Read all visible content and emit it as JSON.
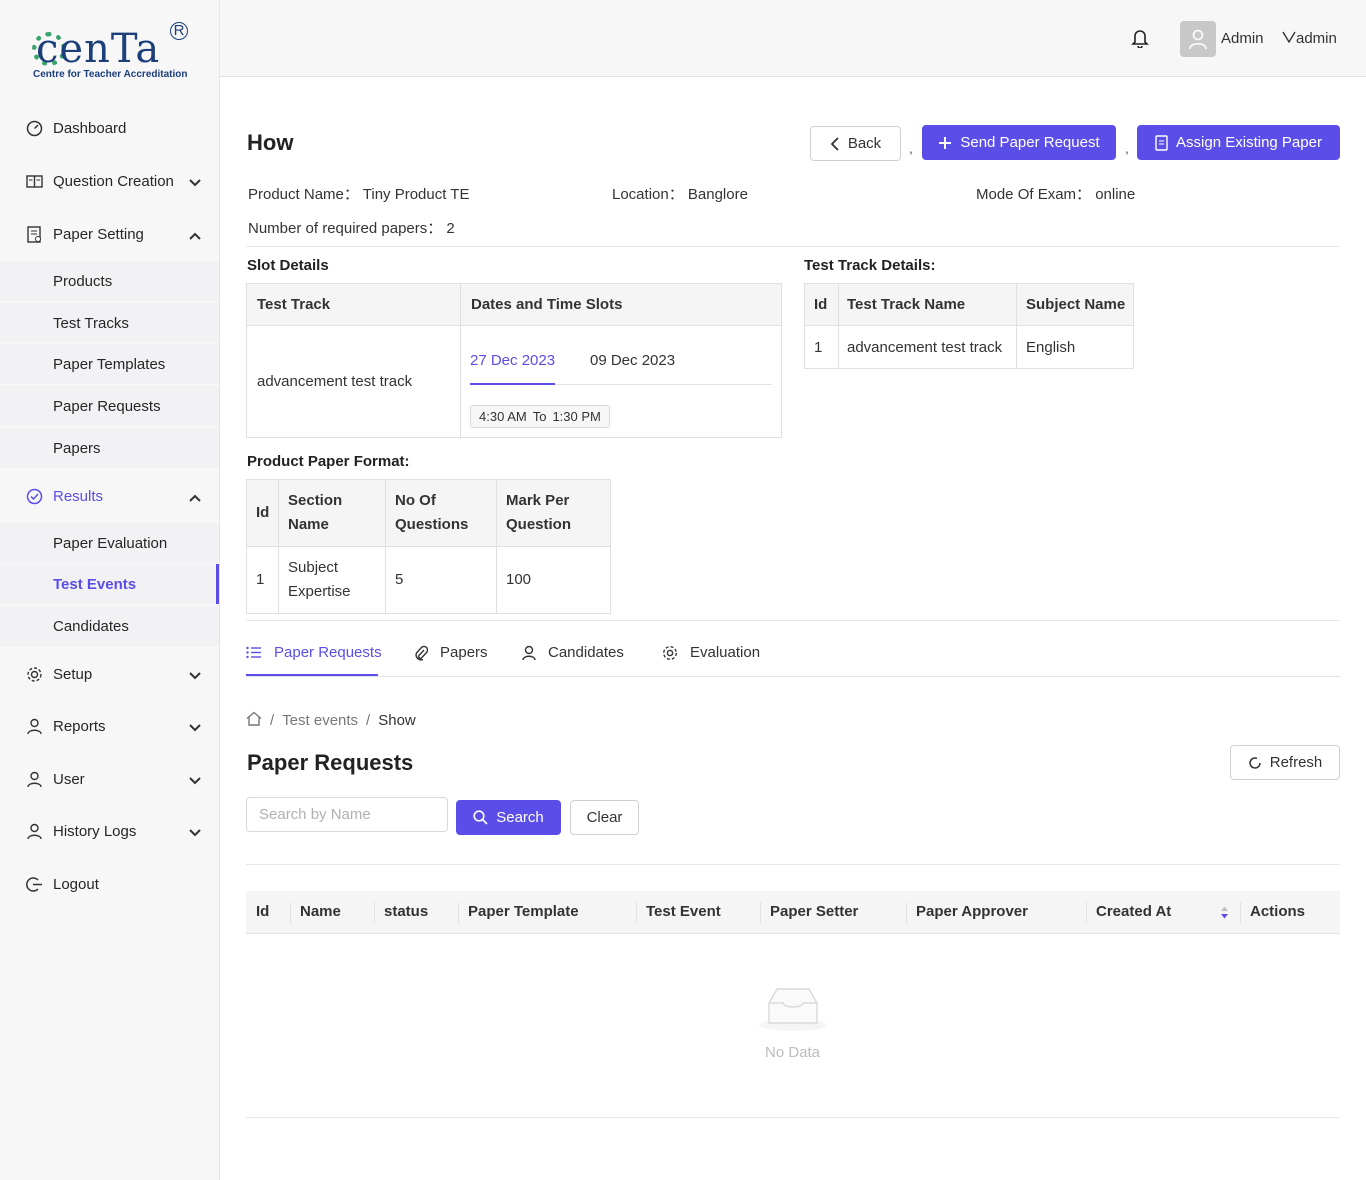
{
  "brand": {
    "logo_text": "cenTa",
    "logo_sub": "Centre for Teacher Accreditation",
    "accent": "#5b4ee8"
  },
  "sidebar": {
    "items": [
      {
        "label": "Dashboard",
        "icon": "dashboard-icon"
      },
      {
        "label": "Question Creation",
        "icon": "book-icon"
      },
      {
        "label": "Paper Setting",
        "icon": "file-icon"
      },
      {
        "label": "Results",
        "icon": "check-circle-icon"
      },
      {
        "label": "Setup",
        "icon": "gear-icon"
      },
      {
        "label": "Reports",
        "icon": "user-icon"
      },
      {
        "label": "User",
        "icon": "user-icon"
      },
      {
        "label": "History Logs",
        "icon": "user-icon"
      },
      {
        "label": "Logout",
        "icon": "logout-icon"
      }
    ],
    "paper_setting_sub": [
      "Products",
      "Test Tracks",
      "Paper Templates",
      "Paper Requests",
      "Papers"
    ],
    "results_sub": [
      "Paper Evaluation",
      "Test Events",
      "Candidates"
    ]
  },
  "header": {
    "admin_label": "Admin",
    "user_label": "admin"
  },
  "page": {
    "title": "How",
    "back_label": "Back",
    "send_label": "Send Paper Request",
    "assign_label": "Assign Existing Paper",
    "sep": ",",
    "product_name": "Product Name： Tiny Product TE",
    "location": "Location： Banglore",
    "mode": "Mode Of Exam： online",
    "required": "Number of required papers： 2"
  },
  "slot": {
    "title": "Slot Details",
    "col1": "Test Track",
    "col2": "Dates and Time Slots",
    "track": "advancement test track",
    "date1": "27 Dec 2023",
    "date2": "09 Dec 2023",
    "time_from": "4:30 AM",
    "time_to_word": "To",
    "time_to": "1:30 PM"
  },
  "track_details": {
    "title": "Test Track Details:",
    "headers": [
      "Id",
      "Test Track Name",
      "Subject Name"
    ],
    "rows": [
      [
        "1",
        "advancement test track",
        "English"
      ]
    ]
  },
  "format": {
    "title": "Product Paper Format:",
    "headers": [
      "Id",
      "Section Name",
      "No Of Questions",
      "Mark Per Question"
    ],
    "rows": [
      [
        "1",
        "Subject Expertise",
        "5",
        "100"
      ]
    ]
  },
  "tabs": [
    "Paper Requests",
    "Papers",
    "Candidates",
    "Evaluation"
  ],
  "breadcrumb": {
    "home": "home-icon",
    "parent": "Test events",
    "current": "Show",
    "sep": "/"
  },
  "requests": {
    "title": "Paper Requests",
    "refresh_label": "Refresh",
    "search_placeholder": "Search by Name",
    "search_label": "Search",
    "clear_label": "Clear",
    "columns": [
      "Id",
      "Name",
      "status",
      "Paper Template",
      "Test Event",
      "Paper Setter",
      "Paper Approver",
      "Created At",
      "Actions"
    ],
    "empty_text": "No Data"
  }
}
